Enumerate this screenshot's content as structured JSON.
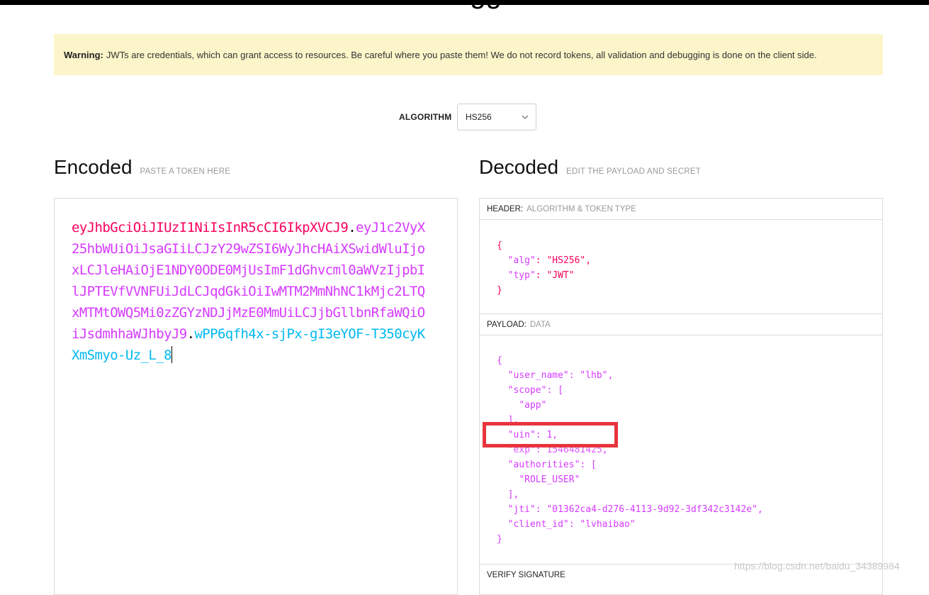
{
  "page": {
    "title": "Debugger"
  },
  "warning": {
    "label": "Warning:",
    "text": "JWTs are credentials, which can grant access to resources. Be careful where you paste them! We do not record tokens, all validation and debugging is done on the client side."
  },
  "algorithm": {
    "label": "ALGORITHM",
    "selected": "HS256"
  },
  "encoded": {
    "title": "Encoded",
    "subtitle": "PASTE A TOKEN HERE",
    "token_header": "eyJhbGciOiJIUzI1NiIsInR5cCI6IkpXVCJ9",
    "token_payload": "eyJ1c2VyX25hbWUiOiJsaGIiLCJzY29wZSI6WyJhcHAiXSwidWluIjoxLCJleHAiOjE1NDY0ODE0MjUsImF1dGhvcml0aWVzIjpbIlJPTEVfVVNFUiJdLCJqdGkiOiIwMTM2MmNhNC1kMjc2LTQxMTMtOWQ5Mi0zZGYzNDJjMzE0MmUiLCJjbGllbnRfaWQiOiJsdmhhaWJhbyJ9",
    "token_signature": "wPP6qfh4x-sjPx-gI3eYOF-T350cyKXmSmyo-Uz_L_8",
    "dot": "."
  },
  "decoded": {
    "title": "Decoded",
    "subtitle": "EDIT THE PAYLOAD AND SECRET",
    "header_label": "HEADER:",
    "header_sub": "ALGORITHM & TOKEN TYPE",
    "header_json": {
      "alg_key": "\"alg\"",
      "alg_val": "\"HS256\"",
      "typ_key": "\"typ\"",
      "typ_val": "\"JWT\""
    },
    "payload_label": "PAYLOAD:",
    "payload_sub": "DATA",
    "payload_json": {
      "user_name_key": "\"user_name\"",
      "user_name_val": "\"lhb\"",
      "scope_key": "\"scope\"",
      "scope_item": "\"app\"",
      "uin_key": "\"uin\"",
      "uin_val": "1",
      "exp_key": "\"exp\"",
      "exp_val": "1546481425",
      "authorities_key": "\"authorities\"",
      "authorities_item": "\"ROLE_USER\"",
      "jti_key": "\"jti\"",
      "jti_val": "\"01362ca4-d276-4113-9d92-3df342c3142e\"",
      "client_id_key": "\"client_id\"",
      "client_id_val": "\"lvhaibao\""
    },
    "verify_label": "VERIFY SIGNATURE"
  },
  "watermark": "https://blog.csdn.net/baidu_34389984",
  "colors": {
    "token_header": "#fb015b",
    "token_payload": "#d63aff",
    "token_signature": "#00b9f1",
    "warning_bg": "#fbf5c9",
    "highlight": "#e8343d"
  }
}
